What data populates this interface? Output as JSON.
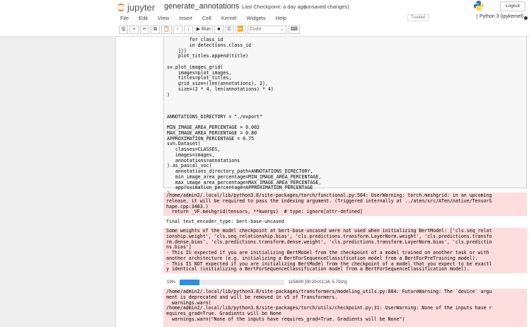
{
  "header": {
    "logo": "jupyter",
    "notebook_name": "generate_annotations",
    "checkpoint": "Last Checkpoint: a day ago",
    "unsaved": "(unsaved changes)",
    "logout": "Logout"
  },
  "menu": [
    "File",
    "Edit",
    "View",
    "Insert",
    "Cell",
    "Kernel",
    "Widgets",
    "Help"
  ],
  "trusted": "Trusted",
  "kernel": "Python 3 (ipykernel)",
  "toolbar": {
    "run": "▶ Run",
    "cell_type": "Code"
  },
  "code_lines": [
    "        for class_id",
    "        in detections.class_id",
    "    ]))",
    "    plot_titles.append(title)",
    "",
    "sv.plot_images_grid(",
    "    images=plot_images,",
    "    titles=plot_titles,",
    "    grid_size=(len(annotations), 2),",
    "    size=(2 * 4, len(annotations) * 4)",
    ")",
    "",
    "",
    "",
    "ANNOTATIONS_DIRECTORY = \"./export\"",
    "",
    "MIN_IMAGE_AREA_PERCENTAGE = 0.002",
    "MAX_IMAGE_AREA_PERCENTAGE = 0.80",
    "APPROXIMATION_PERCENTAGE = 0.75",
    "svn.Dataset(",
    "   classes=CLASSES,",
    "   images=images,",
    "   annotations=annotations",
    ").as_pascal_voc(",
    "   annotations_directory_path=ANNOTATIONS_DIRECTORY,",
    "   min_image_area_percentage=MIN_IMAGE_AREA_PERCENTAGE,",
    "   max_image_area_percentage=MAX_IMAGE_AREA_PERCENTAGE,",
    "   approximation_percentage=APPROXIMATION_PERCENTAGE",
    ")"
  ],
  "outputs": {
    "stderr1": "/home/admin2/.local/lib/python3.8/site-packages/torch/functional.py:504: UserWarning: torch.meshgrid: in an upcoming\nrelease, it will be required to pass the indexing argument. (Triggered internally at ../aten/src/ATen/native/TensorS\nhape.cpp:3483.)\n  return _VF.meshgrid(tensors, **kwargs)  # type: ignore[attr-defined]",
    "stdout1": "final text_encoder_type: bert-base-uncased",
    "stderr2": "Some weights of the model checkpoint at bert-base-uncased were not used when initializing BertModel: ['cls.seq_relat\nionship.weight', 'cls.seq_relationship.bias', 'cls.predictions.transform.LayerNorm.weight', 'cls.predictions.transfo\nrm.dense.bias', 'cls.predictions.transform.dense.weight', 'cls.predictions.transform.LayerNorm.bias', 'cls.predictio\nns.bias']\n- This IS expected if you are initializing BertModel from the checkpoint of a model trained on another task or with\nanother architecture (e.g. initializing a BertForSequenceClassification model from a BertForPreTraining model).\n- This IS NOT expected if you are initializing BertModel from the checkpoint of a model that you expect to be exactl\ny identical (initializing a BertForSequenceClassification model from a BertForSequenceClassification model).",
    "progress": {
      "percent_label": "19%",
      "fraction": 0.19,
      "status": "115/600 [00:20<01:24, 5.71it/s]"
    },
    "stderr3": "/home/admin2/.local/lib/python3.8/site-packages/transformers/modeling_utils.py:884: FutureWarning: The `device` argu\nment is deprecated and will be removed in v5 of Transformers.\n  warnings.warn(\n/home/admin2/.local/lib/python3.8/site-packages/torch/utils/checkpoint.py:31: UserWarning: None of the inputs have r\nequires_grad=True. Gradients will be None\n  warnings.warn(\"None of the inputs have requires_grad=True. Gradients will be None\")"
  }
}
